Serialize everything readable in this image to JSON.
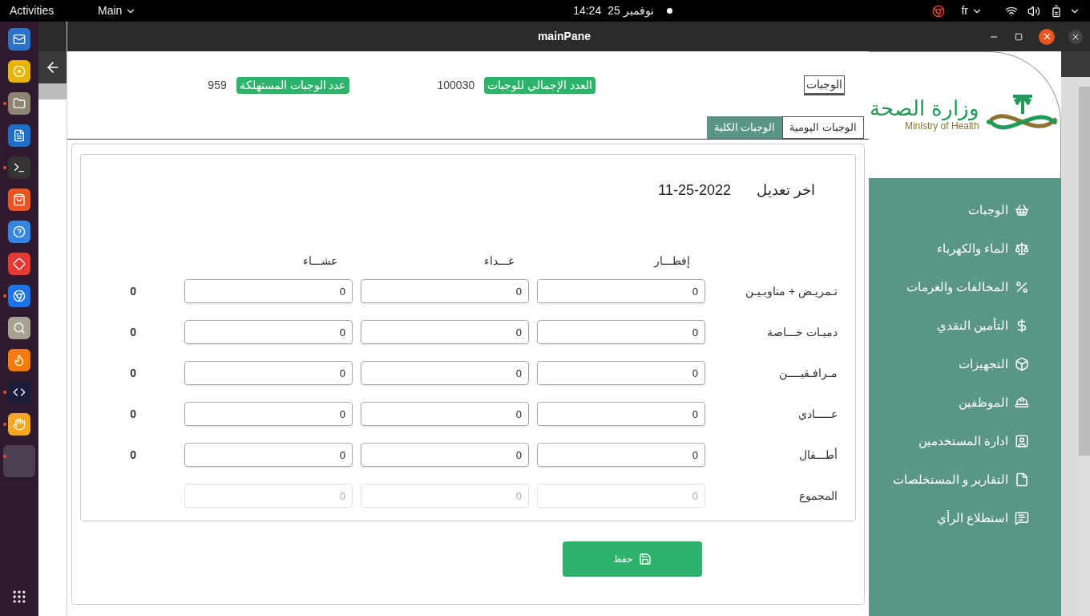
{
  "top_bar": {
    "activities": "Activities",
    "app_menu": "Main",
    "date": "نوفمبر 25",
    "time": "14:24",
    "language": "fr"
  },
  "dock": [
    {
      "running": false
    },
    {
      "running": false
    },
    {
      "running": true
    },
    {
      "running": false
    },
    {
      "running": true
    },
    {
      "running": false
    },
    {
      "running": false
    },
    {
      "running": false
    },
    {
      "running": true
    },
    {
      "running": false
    },
    {
      "running": false
    },
    {
      "running": true
    },
    {
      "running": true
    },
    {
      "running": true
    }
  ],
  "window": {
    "title": "mainPane"
  },
  "page_title": "الوجبات",
  "stats": [
    {
      "label": "العدد الإجمالي للوجبات",
      "value": "100030"
    },
    {
      "label": "عدد الوجبات المستهلكة",
      "value": "959"
    }
  ],
  "tabs": [
    {
      "label": "الوجبات اليومية",
      "selected": false
    },
    {
      "label": "الوجبات الكلية",
      "selected": true
    }
  ],
  "last_modified": {
    "label": "اخر تعديل",
    "value": "11-25-2022"
  },
  "table": {
    "columns": [
      "إفطـــار",
      "غـــداء",
      "عشـــاء"
    ],
    "rows": [
      {
        "label": "تـمريـض + مناوبـيـن",
        "values": [
          "0",
          "0",
          "0"
        ],
        "total": "0",
        "disabled": false
      },
      {
        "label": "دميـات خـــاصة",
        "values": [
          "0",
          "0",
          "0"
        ],
        "total": "0",
        "disabled": false
      },
      {
        "label": "مـرافـقيــــن",
        "values": [
          "0",
          "0",
          "0"
        ],
        "total": "0",
        "disabled": false
      },
      {
        "label": "عـــــادي",
        "values": [
          "0",
          "0",
          "0"
        ],
        "total": "0",
        "disabled": false
      },
      {
        "label": "أطـــفال",
        "values": [
          "0",
          "0",
          "0"
        ],
        "total": "0",
        "disabled": false
      },
      {
        "label": "المجموع",
        "values": [
          "0",
          "0",
          "0"
        ],
        "disabled": true
      }
    ]
  },
  "save_button": "حفظ",
  "sidebar": {
    "logo": {
      "arabic": "وزارة الصحة",
      "english": "Ministry of Health"
    },
    "items": [
      {
        "label": "الوجبات"
      },
      {
        "label": "الماء والكهرباء"
      },
      {
        "label": "المخالفات والغرمات"
      },
      {
        "label": "التأمين النقدي"
      },
      {
        "label": "التجهيزات"
      },
      {
        "label": "الموظفين"
      },
      {
        "label": "ادارة المستخدمين"
      },
      {
        "label": "التقارير و المستخلصات"
      },
      {
        "label": "استطلاع الرأي"
      }
    ]
  }
}
